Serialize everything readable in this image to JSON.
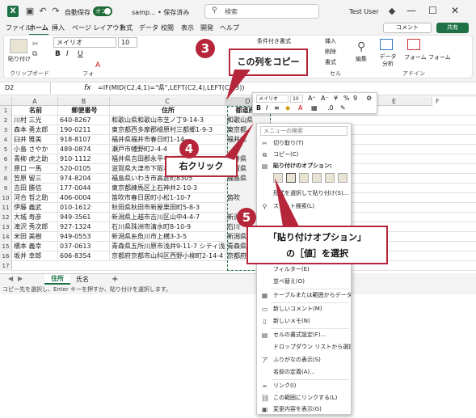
{
  "title": {
    "autosave": "自動保存",
    "toggle": "オン",
    "doc": "samp... • 保存済み",
    "search_placeholder": "検索",
    "user": "Test User"
  },
  "menu": [
    "ファイル",
    "ホーム",
    "挿入",
    "ページ レイアウト",
    "数式",
    "データ",
    "校閲",
    "表示",
    "開発",
    "ヘルプ"
  ],
  "menu_buttons": {
    "comment": "コメント",
    "share": "共有"
  },
  "ribbon": {
    "clipboard_label": "クリップボード",
    "paste": "貼り付け",
    "font_name": "メイリオ",
    "font_size": "10",
    "font_label": "フォ",
    "cond_format": "条件付き書式",
    "insert": "挿入",
    "delete": "削除",
    "format": "書式",
    "cells_label": "セル",
    "edit": "編集",
    "analyze": "データ分析",
    "addin": "アドイン",
    "form_top": "フォーム",
    "form_bottom": "フォーム"
  },
  "formula_bar": {
    "namebox": "D2",
    "fx": "fx",
    "formula": "=IF(MID(C2,4,1)=\"県\",LEFT(C2,4),LEFT(C2,3))"
  },
  "columns": [
    "A",
    "B",
    "C",
    "D",
    "E",
    "F"
  ],
  "headers": [
    "名前",
    "郵便番号",
    "住所",
    "都道府県"
  ],
  "rows": [
    [
      "川村 三光",
      "640-8267",
      "和歌山県和歌山市芝ノ丁9-14-3",
      "和歌山県"
    ],
    [
      "森本 勇太郎",
      "190-0211",
      "東京都西多摩郡檜原村三都郷1-9-3",
      "東京都"
    ],
    [
      "臼井 雅美",
      "918-8107",
      "福井県福井市春日町1-14-",
      "福井県"
    ],
    [
      "小島 さやか",
      "489-0874",
      "瀬戸市幡野町2-4-4",
      ""
    ],
    [
      "青柳 虎之助",
      "910-1112",
      "福井県吉田郡永平寺町松岡",
      "福井県"
    ],
    [
      "原口 一馬",
      "520-0105",
      "滋賀県大津市下阪本1-5-8",
      "滋賀県"
    ],
    [
      "笠原 留三",
      "974-8204",
      "福島県いわき市高倉町8305",
      "福島県"
    ],
    [
      "吉田 勝信",
      "177-0044",
      "東京都練馬区上石神井2-10-3",
      ""
    ],
    [
      "河合 哲之助",
      "406-0004",
      "笛吹市春日居町小松1-10-7",
      "笛吹"
    ],
    [
      "伊藤 義武",
      "010-1612",
      "秋田県秋田市新屋栗田町5-8-3",
      ""
    ],
    [
      "大城 寿彦",
      "949-3561",
      "新潟県上越市吉川区山中4-4-7",
      "新潟"
    ],
    [
      "滝沢 秀次郎",
      "927-1324",
      "石川県珠洲市清水町8-10-9",
      "石川"
    ],
    [
      "米田 美樹",
      "949-0553",
      "新潟県糸魚川市上横3-3-5",
      "新潟県"
    ],
    [
      "橋本 義幸",
      "037-0613",
      "青森県五所川原市浅井9-11-7 シティ浅井 1301",
      "青森県"
    ],
    [
      "坂井 幸郎",
      "606-8354",
      "京都府京都市山科区西野小柳町2-14-4 グラン",
      "京都府"
    ]
  ],
  "row_numbers": [
    "1",
    "2",
    "3",
    "4",
    "5",
    "6",
    "7",
    "8",
    "9",
    "10",
    "11",
    "12",
    "13",
    "14",
    "15",
    "16",
    "17"
  ],
  "sheets": [
    "住所",
    "氏名"
  ],
  "status": "コピー先を選択し、Enter キーを押すか、貼り付けを選択します。",
  "mini_toolbar": {
    "font": "メイリオ",
    "size": "10"
  },
  "context_menu": {
    "search": "メニューの検索",
    "items": [
      "切り取り(T)",
      "コピー(C)",
      "貼り付けのオプション:",
      "形式を選択して貼り付け(S)...",
      "スマート検索(L)",
      "フィルター(E)",
      "並べ替え(O)",
      "テーブルまたは範囲からデータを...",
      "新しいコメント(M)",
      "新しいメモ(N)",
      "セルの書式設定(F)...",
      "ドロップダウン リストから選択(K)...",
      "ふりがなの表示(S)",
      "名前の定義(A)...",
      "リンク(I)",
      "この範囲にリンクする(L)",
      "変更内容を表示(G)"
    ]
  },
  "callouts": {
    "s3": "3",
    "t3": "この列をコピー",
    "s4": "4",
    "t4": "右クリック",
    "s5": "5",
    "t5a": "「貼り付けオプション」",
    "t5b": "の［値］を選択"
  },
  "colors": {
    "accent": "#1e7145",
    "callout": "#b5263a"
  }
}
